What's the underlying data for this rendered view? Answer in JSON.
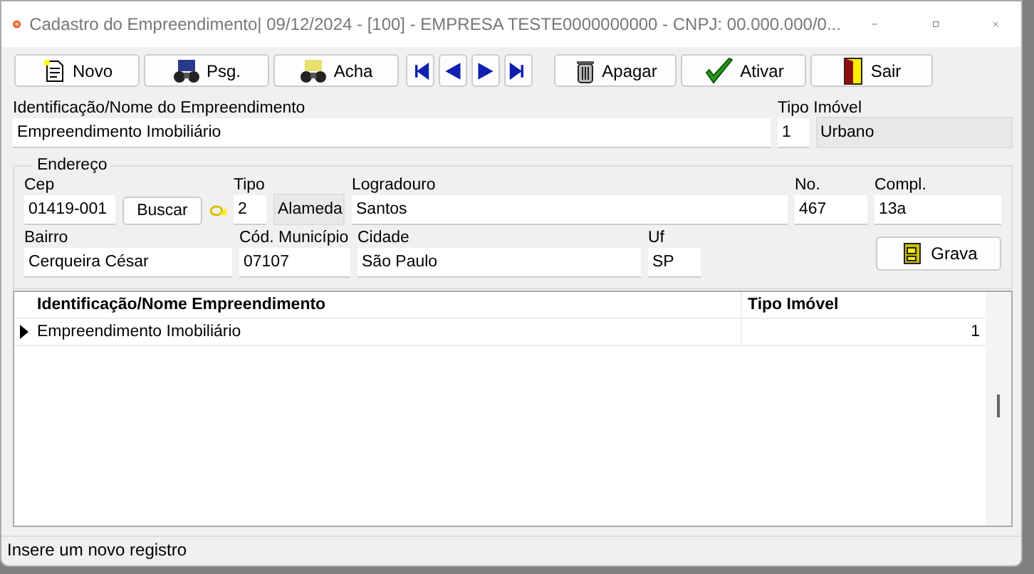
{
  "window": {
    "title": "Cadastro do Empreendimento|  09/12/2024 - [100] - EMPRESA TESTE0000000000 - CNPJ: 00.000.000/0..."
  },
  "toolbar": [
    {
      "kind": "text",
      "label": "Novo"
    },
    {
      "kind": "text",
      "label": "Psg."
    },
    {
      "kind": "text",
      "label": "Acha"
    },
    {
      "kind": "nav-first"
    },
    {
      "kind": "nav-prev"
    },
    {
      "kind": "nav-next"
    },
    {
      "kind": "nav-last"
    },
    {
      "kind": "text",
      "label": "Apagar"
    },
    {
      "kind": "text",
      "label": "Ativar"
    },
    {
      "kind": "text",
      "label": "Sair"
    }
  ],
  "main_fields": [
    {
      "label": "Identificação/Nome do Empreendimento",
      "value": "Empreendimento Imobiliário",
      "kind": "edit"
    },
    {
      "label": "Tipo Imóvel",
      "value": "1",
      "kind": "edit"
    },
    {
      "value": "Urbano",
      "kind": "readonly"
    }
  ],
  "address": {
    "title": "Endereço",
    "row_1": [
      {
        "label": "Cep",
        "value": "01419-001",
        "kind": "edit"
      },
      {
        "label": "Buscar",
        "kind": "button"
      },
      {
        "kind": "lookup-icon"
      },
      {
        "label": "Tipo",
        "value": "2",
        "kind": "edit"
      },
      {
        "value": "Alameda",
        "kind": "readonly"
      },
      {
        "label": "Logradouro",
        "value": "Santos",
        "kind": "edit"
      },
      {
        "label": "No.",
        "value": "467",
        "kind": "edit"
      },
      {
        "label": "Compl.",
        "value": "13a",
        "kind": "edit"
      }
    ],
    "row_2": [
      {
        "label": "Bairro",
        "value": "Cerqueira César",
        "kind": "edit"
      },
      {
        "label": "Cód. Município",
        "value": "07107",
        "kind": "edit"
      },
      {
        "label": "Cidade",
        "value": "São Paulo",
        "kind": "edit"
      },
      {
        "label": "Uf",
        "value": "SP",
        "kind": "edit"
      }
    ],
    "save_button": "Grava"
  },
  "table": {
    "columns": [
      "Identificação/Nome Empreendimento",
      "Tipo Imóvel"
    ],
    "rows": [
      {
        "cells": [
          "Empreendimento Imobiliário",
          "1"
        ],
        "selected": true
      }
    ]
  },
  "status_bar": "Insere um novo registro"
}
